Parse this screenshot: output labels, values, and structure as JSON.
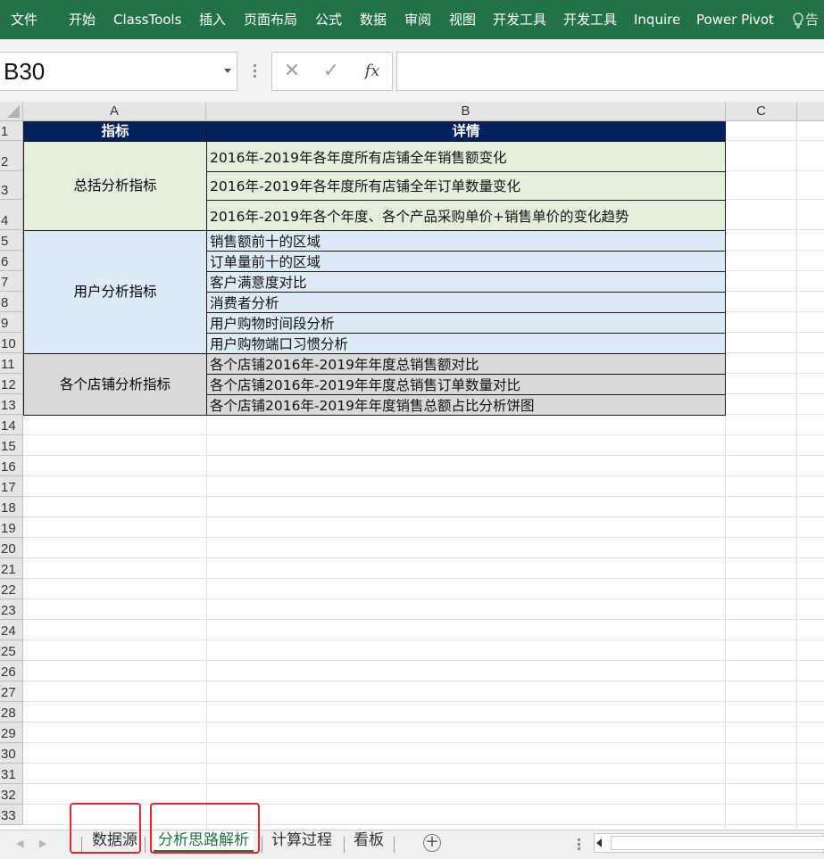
{
  "ribbon": {
    "tabs": [
      "文件",
      "开始",
      "ClassTools",
      "插入",
      "页面布局",
      "公式",
      "数据",
      "审阅",
      "视图",
      "开发工具",
      "开发工具",
      "Inquire",
      "Power Pivot"
    ],
    "tell_me": "告"
  },
  "formula_bar": {
    "name_box": "B30",
    "cancel": "✕",
    "enter": "✓",
    "fx": "fx",
    "content": ""
  },
  "sheet": {
    "columns": [
      "A",
      "B",
      "C"
    ],
    "rows": [
      "1",
      "2",
      "3",
      "4",
      "5",
      "6",
      "7",
      "8",
      "9",
      "10",
      "11",
      "12",
      "13",
      "14",
      "15",
      "16",
      "17",
      "18",
      "19",
      "20",
      "21",
      "22",
      "23",
      "24",
      "25",
      "26",
      "27",
      "28",
      "29",
      "30",
      "31",
      "32",
      "33"
    ],
    "header": {
      "a": "指标",
      "b": "详情"
    },
    "groups": [
      {
        "name": "总括分析指标",
        "details": [
          "2016年-2019年各年度所有店铺全年销售额变化",
          "2016年-2019年各年度所有店铺全年订单数量变化",
          "2016年-2019年各个年度、各个产品采购单价+销售单价的变化趋势"
        ]
      },
      {
        "name": "用户分析指标",
        "details": [
          "销售额前十的区域",
          "订单量前十的区域",
          "客户满意度对比",
          "消费者分析",
          "用户购物时间段分析",
          "用户购物端口习惯分析"
        ]
      },
      {
        "name": "各个店铺分析指标",
        "details": [
          "各个店铺2016年-2019年年度总销售额对比",
          "各个店铺2016年-2019年年度总销售订单数量对比",
          "各个店铺2016年-2019年年度销售总额占比分析饼图"
        ]
      }
    ]
  },
  "sheet_tabs": {
    "tabs": [
      "数据源",
      "分析思路解析",
      "计算过程",
      "看板"
    ],
    "active": "分析思路解析"
  },
  "colors": {
    "ribbon": "#217346",
    "header_fill": "#002060",
    "group1_fill": "#e2efda",
    "group2_fill": "#ddebf7",
    "group3_fill": "#d9d9d9",
    "highlight_box": "#e8262d"
  },
  "icons": [
    "lightbulb-icon",
    "cancel-icon",
    "enter-icon",
    "function-icon",
    "select-all-icon",
    "add-sheet-icon",
    "scroll-left-icon"
  ]
}
